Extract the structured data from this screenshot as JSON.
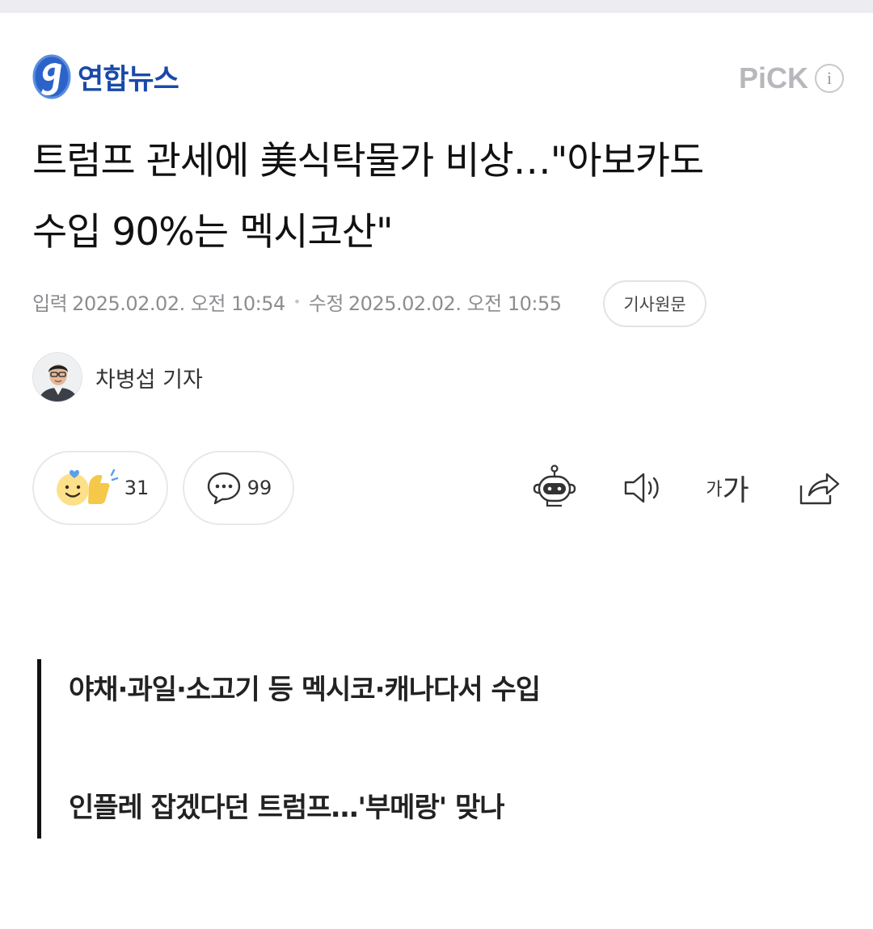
{
  "press": {
    "name": "연합뉴스"
  },
  "pick": {
    "label": "PiCK",
    "info_glyph": "i"
  },
  "article": {
    "title_line1": "트럼프 관세에 美식탁물가 비상…\"아보카도",
    "title_line2": "수입 90%는 멕시코산\"",
    "published_label": "입력",
    "published": "2025.02.02. 오전 10:54",
    "modified_label": "수정",
    "modified": "2025.02.02. 오전 10:55",
    "original_button": "기사원문",
    "author": "차병섭 기자"
  },
  "reactions": {
    "like_count": "31",
    "comment_count": "99"
  },
  "toolbar": {
    "font_small": "가",
    "font_large": "가",
    "icons": [
      "robot-summary-icon",
      "speaker-icon",
      "font-size-icon",
      "share-icon"
    ]
  },
  "summary": {
    "line1": "야채·과일·소고기 등 멕시코·캐나다서 수입",
    "line2": "인플레 잡겠다던 트럼프…'부메랑' 맞나"
  },
  "colors": {
    "brand_blue": "#1a4aa8",
    "pick_gray": "#b7b7bd",
    "text": "#111111",
    "meta_gray": "#8d8d92"
  }
}
